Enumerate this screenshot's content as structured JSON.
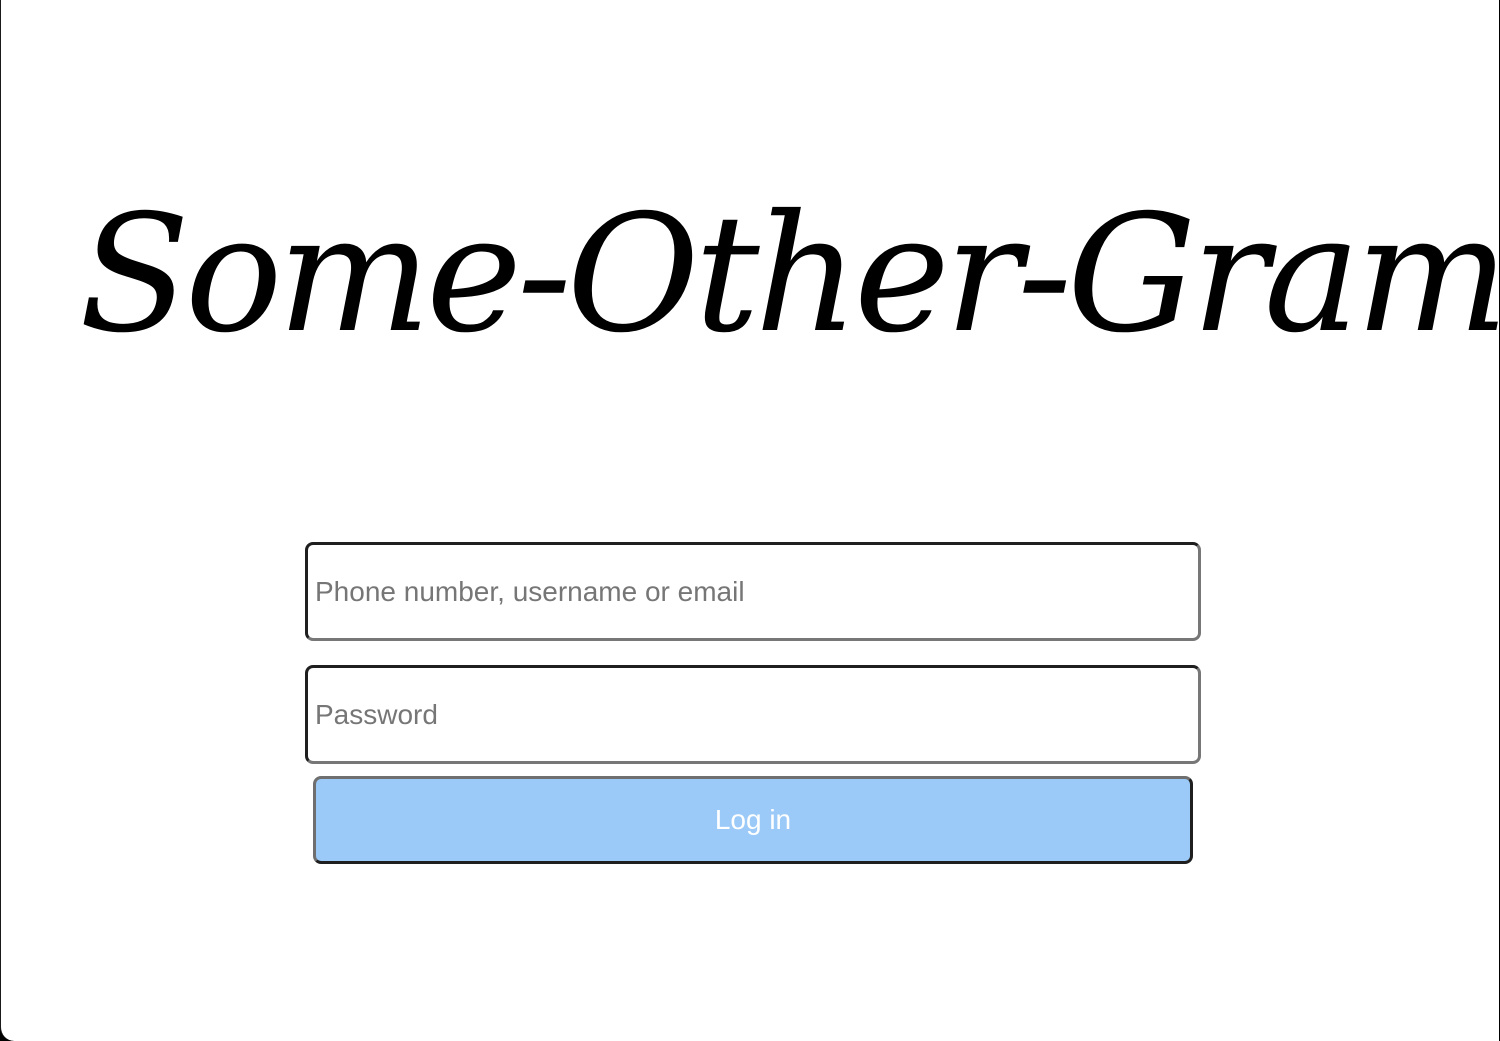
{
  "app": {
    "logo_text": "Some-Other-Gram"
  },
  "login_form": {
    "username_placeholder": "Phone number, username or email",
    "username_value": "",
    "password_placeholder": "Password",
    "password_value": "",
    "submit_label": "Log in"
  },
  "colors": {
    "button_background": "#9ccaf8",
    "button_text": "#ffffff",
    "placeholder_text": "#767676",
    "logo_text": "#000000"
  }
}
